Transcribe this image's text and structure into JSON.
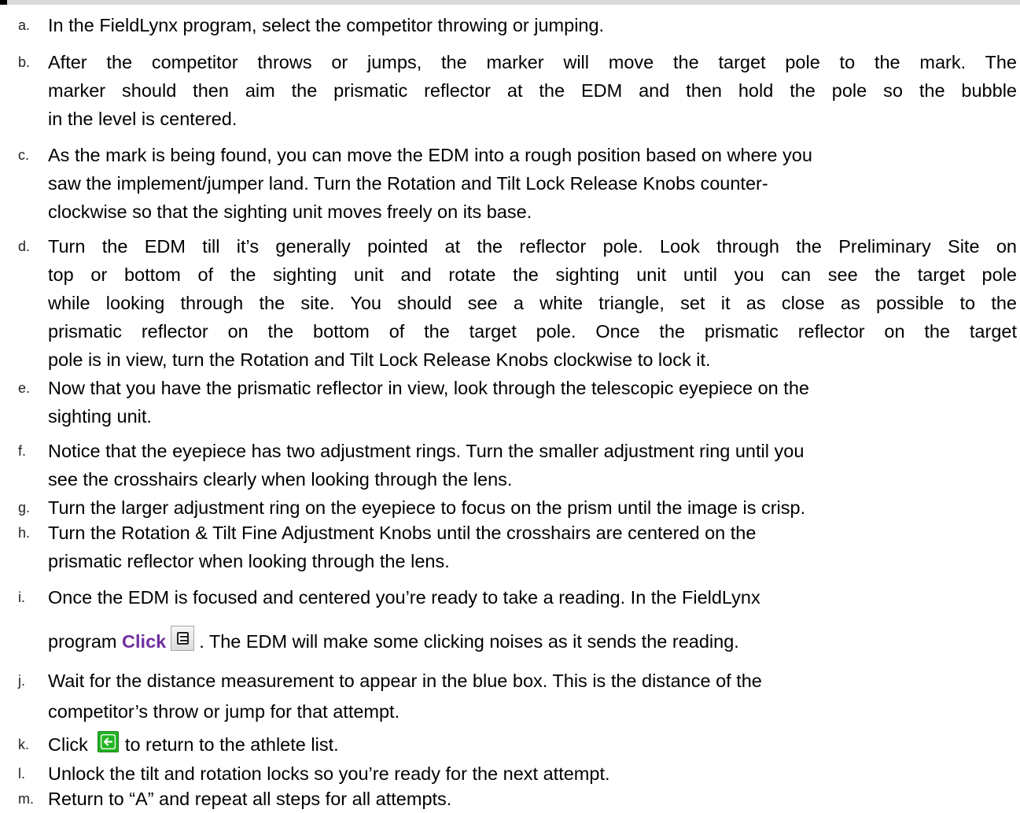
{
  "steps": [
    {
      "marker": "a.",
      "lines": [
        "In the FieldLynx program, select the competitor throwing or jumping."
      ]
    },
    {
      "marker": "b.",
      "lines": [
        "After the competitor throws or jumps, the marker will move the target pole to the mark. The",
        "marker should then aim the prismatic reflector at the EDM and then hold the pole so the bubble",
        "in the level is centered."
      ]
    },
    {
      "marker": "c.",
      "lines": [
        "As the mark is being found, you can move the EDM into a rough position based on where you",
        "saw the implement/jumper land. Turn the Rotation and Tilt Lock Release Knobs counter-",
        "clockwise so that the sighting unit moves freely on its base."
      ]
    },
    {
      "marker": "d.",
      "lines": [
        "Turn the EDM till it’s generally pointed at the reflector pole. Look through the Preliminary Site on",
        "top or bottom of the sighting unit and rotate the sighting unit until you can see the target pole",
        "while looking through the site. You should see a white triangle, set it as close as possible to the",
        "prismatic reflector on the bottom of the target pole. Once the prismatic reflector on the target",
        "pole is in view, turn the Rotation and Tilt Lock Release Knobs clockwise to lock it."
      ]
    },
    {
      "marker": "e.",
      "lines": [
        "Now that you have the prismatic reflector in view, look through the telescopic eyepiece on the",
        "sighting unit."
      ]
    },
    {
      "marker": "f.",
      "lines": [
        "Notice that the eyepiece has two adjustment rings. Turn the smaller adjustment ring until you",
        "see the crosshairs clearly when looking through the lens."
      ]
    },
    {
      "marker": "g.",
      "lines": [
        "Turn the larger adjustment ring on the eyepiece to focus on the prism until the image is crisp."
      ]
    },
    {
      "marker": "h.",
      "lines": [
        "Turn the Rotation & Tilt Fine Adjustment Knobs until the crosshairs are centered on the",
        "prismatic reflector when looking through the lens."
      ]
    },
    {
      "marker": "i.",
      "line1": "Once the EDM is focused and centered you’re ready to take a reading. In the FieldLynx",
      "line2_before": "program ",
      "click_word": "Click",
      "line2_after": ". The EDM will make some clicking noises as it sends the reading."
    },
    {
      "marker": "j.",
      "lines": [
        "Wait for the distance measurement to appear in the blue box. This is the distance of the",
        "competitor’s throw or jump for that attempt."
      ]
    },
    {
      "marker": "k.",
      "before": "Click",
      "after": "to return to the athlete list."
    },
    {
      "marker": "l.",
      "lines": [
        "Unlock the tilt and rotation locks so you’re ready for the next attempt."
      ]
    },
    {
      "marker": "m.",
      "lines": [
        "Return to “A” and repeat all steps for all attempts."
      ]
    }
  ],
  "icons": {
    "edm_reading": "edm-read-icon",
    "back": "back-arrow-icon"
  },
  "colors": {
    "click_word": "#7030a0",
    "back_button": "#22b422",
    "header_bar": "#d9d9d9"
  }
}
